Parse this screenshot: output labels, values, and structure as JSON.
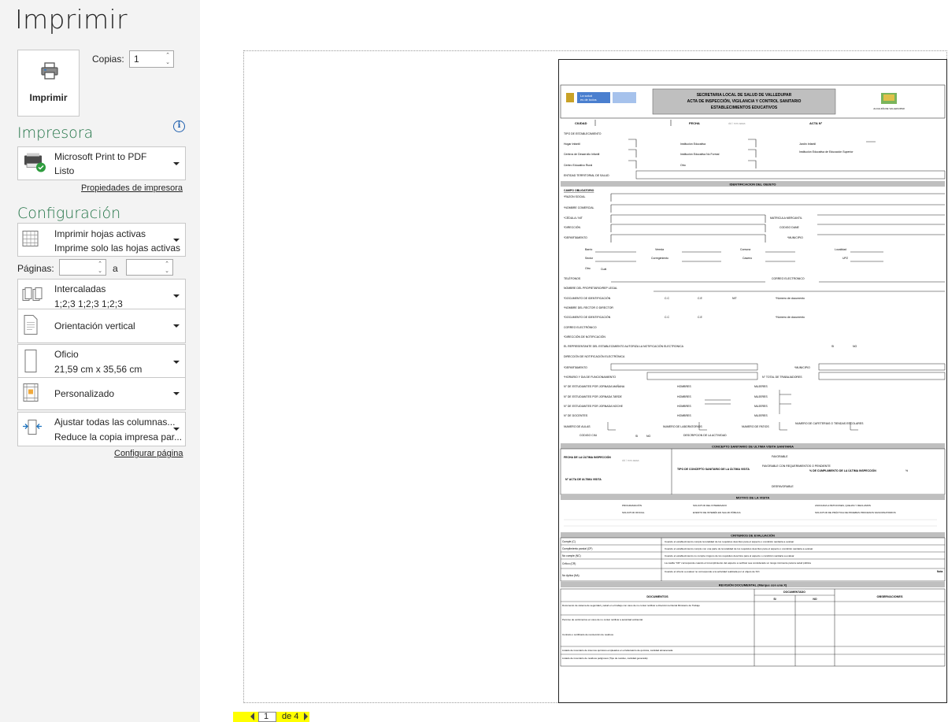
{
  "title": "Imprimir",
  "print_button": {
    "label": "Imprimir",
    "icon": "printer-icon"
  },
  "copies": {
    "label": "Copias:",
    "value": "1"
  },
  "printer_section": {
    "heading": "Impresora",
    "info_icon": "info-icon",
    "printer_name": "Microsoft Print to PDF",
    "printer_status": "Listo",
    "properties_link": "Propiedades de impresora"
  },
  "settings_section": {
    "heading": "Configuración",
    "what_to_print": {
      "line1": "Imprimir hojas activas",
      "line2": "Imprime solo las hojas activas"
    },
    "pages_label": "Páginas:",
    "pages_from": "",
    "pages_to_label": "a",
    "pages_to": "",
    "collation": {
      "line1": "Intercaladas",
      "line2": "1;2;3   1;2;3   1;2;3"
    },
    "orientation": {
      "line1": "Orientación vertical"
    },
    "paper": {
      "line1": "Oficio",
      "line2": "21,59 cm x 35,56 cm"
    },
    "margins": {
      "line1": "Personalizado"
    },
    "scaling": {
      "line1": "Ajustar todas las columnas...",
      "line2": "Reduce la copia impresa par..."
    },
    "page_setup_link": "Configurar página"
  },
  "pager": {
    "current": "1",
    "total_label": "de 4"
  },
  "document": {
    "logo_text_1": "La salud",
    "logo_text_2": "es de todos",
    "logo_ministry": "Minsalud",
    "header_1": "SECRETARIA LOCAL DE SALUD DE VALLEDUPAR",
    "header_2": "ACTA DE INSPECCIÓN, VIGILANCIA Y CONTROL SANITARIO",
    "header_3": "ESTABLECIMIENTOS EDUCATIVOS",
    "alcaldia": "ALCALDÍA DE VALLEDUPAR",
    "ciudad": "CIUDAD",
    "fecha": "FECHA",
    "fecha_ph": "dd / mm aaaa",
    "acta": "ACTA N°",
    "tipo_est": "TIPO DE ESTABLECIMIENTO",
    "hogar": "Hogar Infantil",
    "inst_edu": "Institución Educativa",
    "jardin": "Jardín Infantil",
    "cdi": "Centros de Desarrollo Infantil",
    "inst_noformal": "Institución Educativa No Formal",
    "inst_superior": "Institución Educativa de Educación Superior",
    "centro_rural": "Centro Educativo Rural",
    "otro": "Otro",
    "entidad": "ENTIDAD TERRITORIAL DE SALUD",
    "sec_ident": "IDENTIFICACION DEL OBJETO",
    "campo_oblig": "CAMPO OBLIGATORIO",
    "razon": "*RAZON SOCIAL",
    "nombre_com": "*NOMBRE COMERCIAL",
    "cedula": "*CÉDULA / NIT",
    "matricula": "MATRICULA MERCANTIL",
    "direccion": "*DIRECCIÓN",
    "codigo_dane": "CODIGO DANE",
    "departamento": "*DEPARTAMENTO",
    "municipio": "*MUNICIPIO",
    "barrio": "Barrio",
    "vereda": "Vereda",
    "comuna": "Comuna",
    "localidad": "Localidad",
    "sector": "Sector",
    "corregimiento": "Corregimiento",
    "caserio": "Caserío",
    "upz": "UPZ",
    "otro2": "Otro",
    "cual": "Cuál",
    "telefonos": "TELÉFONOS",
    "correo": "CORREO ELECTRONICO",
    "propietario": "NOMBRE DEL PROPIETARIO/REP LEGAL",
    "doc_ident": "*DOCUMENTO DE IDENTIFICACIÓN",
    "cc": "C.C",
    "ce": "C.E",
    "nit": "NIT",
    "num_doc": "*Número de documento",
    "rector": "*NOMBRE DEL RECTOR O DIRECTOR",
    "correo2": "CORREO ELECTRÓNICO",
    "dir_notif": "*DIRECCIÓN DE NOTIFICACIÓN",
    "autoriza": "EL REPRESENTANTE DEL ESTABLECIMIENTO AUTORIZA LA NOTIFICACIÓN ELECTRONICA",
    "si": "SI",
    "no": "NO",
    "dir_notif_el": "DIRECCIÓN DE NOTIFICACIÓN ELECTRÓNICA",
    "horario": "*HORARIO Y DIA DE FUNCIONAMIENTO",
    "total_trab": "N° TOTAL DE TRABAJADORES",
    "est_manana": "N° DE ESTUDIANTES POR JORNADA MAÑANA",
    "est_tarde": "N° DE ESTUDIANTES POR JORNADA TARDE",
    "est_noche": "N° DE ESTUDIANTES POR JORNADA NOCHE",
    "docentes": "N° DE DOCENTES",
    "hombres": "HOMBRES",
    "mujeres": "MUJERES",
    "aulas": "NUMERO DE AULAS",
    "laboratorios": "NUMERO DE LABORATORIOS",
    "patios": "NUMERO DE PATIOS",
    "cafeterias": "NUMERO DE CAFETERIAS O TIENDAS ESCOLARES",
    "ciiu": "CODIGO CIIU",
    "desc_act": "DESCRIPCION DE LA ACTIVIDAD",
    "sec_concepto": "CONCEPTO SANITARIO DE ULTIMA VISITA SANITARIA",
    "fecha_ult": "FECHA DE LA ÚLTIMA INSPECCIÓN",
    "num_acta_ult": "N° ACTA DE ULTIMA VISITA",
    "tipo_concepto": "TIPO DE CONCEPTO SANITARIO DE LA ÚLTIMA VISITA",
    "favorable": "FAVORABLE",
    "fav_req": "FAVORABLE CON REQUERIMIENTOS O PENDIENTE",
    "desfavorable": "DESFAVORABLE",
    "pct_cumpl": "% DE CUMPLIMIENTO DE LA ÚLTIMA INSPECCIÓN",
    "pct": "%",
    "sec_motivo": "MOTIVO DE LA VISITA",
    "programacion": "PROGRAMACIÓN",
    "solicitud_int": "SOLICITUD DEL INTERESADO",
    "asociada": "ASOCIADA A PETICIONES, QUEJAS Y RECLAMOS",
    "solicitud_of": "SOLICITUD OFICIAL",
    "evento": "EVENTO DE INTERÉS EN SALUD PÚBLICA",
    "solicitud_pract": "SOLICITUD DE PRÁCTICA DE PRUEBAS PROCESOS SANCIONATORIOS",
    "sec_criterios": "CRITERIOS DE EVALUACIÓN",
    "cumple": "Cumple (C)",
    "cumple_desc": "Cuando el establecimiento cumple la totalidad de los requisitos descritos para el aspecto o condición sanitaria a evaluar",
    "parcial": "Cumplimiento parcial (CP)",
    "parcial_desc": "Cuando el establecimiento cumple con una parte de la totalidad de los requisitos descritos para el aspecto o condición sanitaria a evaluar",
    "nocumple": "No cumple (NC)",
    "nocumple_desc": "Cuando el establecimiento no cumple ninguno de los requisitos descritos para el aspecto o condición sanitaria a evaluar",
    "critico": "Crítico (CR)",
    "critico_desc": "La casilla \"CR\" corresponde cuando el incumplimiento del aspecto a verificar sea considerado un riesgo inminente para la salud pública",
    "noaplica": "No Aplica (NA)",
    "noaplica_desc": "Cuando el criterio a evaluar no corresponde a la actividad realizada por el objeto de IVC",
    "nota": "Nota",
    "sec_revision": "REVISIÓN DOCUMENTAL (Marque con una X)",
    "documentos": "DOCUMENTOS",
    "documentado": "DOCUMENTADO",
    "observaciones": "OBSERVACIONES",
    "doc_row1": "Documento de sistema de seguridad y salud en el trabajo con caso de no contar notificar a dirección territorial Ministerio de Trabajo",
    "doc_row2": "Permiso de vertimientos en caso de no contar notificar a autoridad ambiental",
    "doc_row3": "Contrato o certificado de recolección de residuos",
    "doc_row4": "Listado de inventario de insumos químicos empleados en el laboratorio de química, cantidad almacenada",
    "doc_row5": "Listado de inventario de residuos peligrosos (Tipo de residuo, cantidad generada)"
  }
}
